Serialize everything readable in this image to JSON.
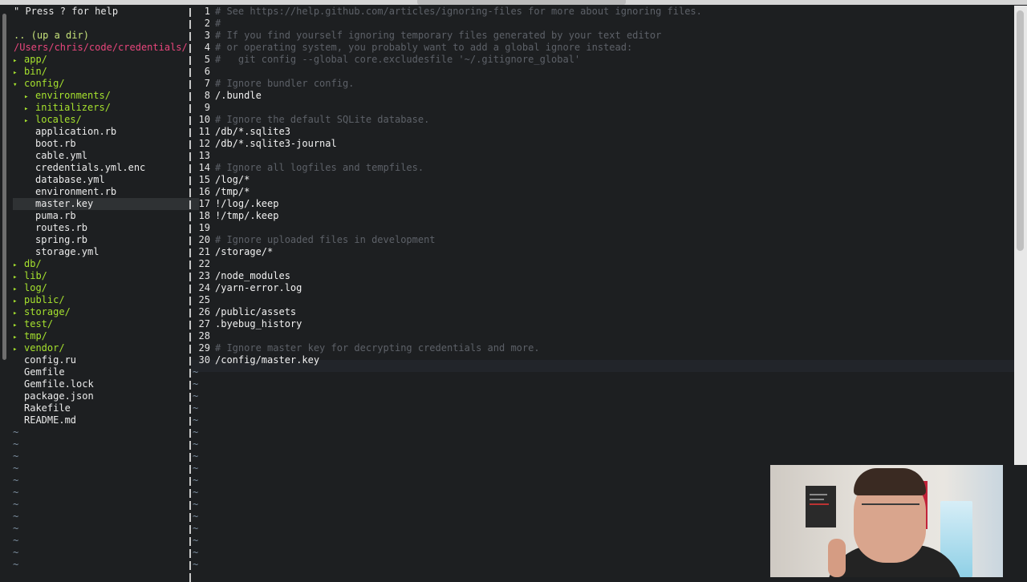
{
  "tree": {
    "help": "\" Press ? for help",
    "up_dir": ".. (up a dir)",
    "root_path": "/Users/chris/code/credentials/",
    "entries": [
      {
        "label": "app/",
        "type": "dir",
        "indent": 1,
        "expanded": false
      },
      {
        "label": "bin/",
        "type": "dir",
        "indent": 1,
        "expanded": false
      },
      {
        "label": "config/",
        "type": "dir",
        "indent": 1,
        "expanded": true
      },
      {
        "label": "environments/",
        "type": "dir",
        "indent": 2,
        "expanded": false
      },
      {
        "label": "initializers/",
        "type": "dir",
        "indent": 2,
        "expanded": false
      },
      {
        "label": "locales/",
        "type": "dir",
        "indent": 2,
        "expanded": false
      },
      {
        "label": "application.rb",
        "type": "file",
        "indent": 2
      },
      {
        "label": "boot.rb",
        "type": "file",
        "indent": 2
      },
      {
        "label": "cable.yml",
        "type": "file",
        "indent": 2
      },
      {
        "label": "credentials.yml.enc",
        "type": "file",
        "indent": 2
      },
      {
        "label": "database.yml",
        "type": "file",
        "indent": 2
      },
      {
        "label": "environment.rb",
        "type": "file",
        "indent": 2
      },
      {
        "label": "master.key",
        "type": "file",
        "indent": 2,
        "selected": true
      },
      {
        "label": "puma.rb",
        "type": "file",
        "indent": 2
      },
      {
        "label": "routes.rb",
        "type": "file",
        "indent": 2
      },
      {
        "label": "spring.rb",
        "type": "file",
        "indent": 2
      },
      {
        "label": "storage.yml",
        "type": "file",
        "indent": 2
      },
      {
        "label": "db/",
        "type": "dir",
        "indent": 1,
        "expanded": false
      },
      {
        "label": "lib/",
        "type": "dir",
        "indent": 1,
        "expanded": false
      },
      {
        "label": "log/",
        "type": "dir",
        "indent": 1,
        "expanded": false
      },
      {
        "label": "public/",
        "type": "dir",
        "indent": 1,
        "expanded": false
      },
      {
        "label": "storage/",
        "type": "dir",
        "indent": 1,
        "expanded": false
      },
      {
        "label": "test/",
        "type": "dir",
        "indent": 1,
        "expanded": false
      },
      {
        "label": "tmp/",
        "type": "dir",
        "indent": 1,
        "expanded": false
      },
      {
        "label": "vendor/",
        "type": "dir",
        "indent": 1,
        "expanded": false
      },
      {
        "label": "config.ru",
        "type": "file",
        "indent": 1
      },
      {
        "label": "Gemfile",
        "type": "file",
        "indent": 1
      },
      {
        "label": "Gemfile.lock",
        "type": "file",
        "indent": 1
      },
      {
        "label": "package.json",
        "type": "file",
        "indent": 1
      },
      {
        "label": "Rakefile",
        "type": "file",
        "indent": 1
      },
      {
        "label": "README.md",
        "type": "file",
        "indent": 1
      }
    ],
    "empty_marker": "~"
  },
  "editor": {
    "lines": [
      {
        "n": "1",
        "text": "# See https://help.github.com/articles/ignoring-files for more about ignoring files.",
        "comment": true
      },
      {
        "n": "2",
        "text": "#",
        "comment": true
      },
      {
        "n": "3",
        "text": "# If you find yourself ignoring temporary files generated by your text editor",
        "comment": true
      },
      {
        "n": "4",
        "text": "# or operating system, you probably want to add a global ignore instead:",
        "comment": true
      },
      {
        "n": "5",
        "text": "#   git config --global core.excludesfile '~/.gitignore_global'",
        "comment": true
      },
      {
        "n": "6",
        "text": "",
        "comment": false
      },
      {
        "n": "7",
        "text": "# Ignore bundler config.",
        "comment": true
      },
      {
        "n": "8",
        "text": "/.bundle",
        "comment": false
      },
      {
        "n": "9",
        "text": "",
        "comment": false
      },
      {
        "n": "10",
        "text": "# Ignore the default SQLite database.",
        "comment": true
      },
      {
        "n": "11",
        "text": "/db/*.sqlite3",
        "comment": false
      },
      {
        "n": "12",
        "text": "/db/*.sqlite3-journal",
        "comment": false
      },
      {
        "n": "13",
        "text": "",
        "comment": false
      },
      {
        "n": "14",
        "text": "# Ignore all logfiles and tempfiles.",
        "comment": true
      },
      {
        "n": "15",
        "text": "/log/*",
        "comment": false
      },
      {
        "n": "16",
        "text": "/tmp/*",
        "comment": false
      },
      {
        "n": "17",
        "text": "!/log/.keep",
        "comment": false
      },
      {
        "n": "18",
        "text": "!/tmp/.keep",
        "comment": false
      },
      {
        "n": "19",
        "text": "",
        "comment": false
      },
      {
        "n": "20",
        "text": "# Ignore uploaded files in development",
        "comment": true
      },
      {
        "n": "21",
        "text": "/storage/*",
        "comment": false
      },
      {
        "n": "22",
        "text": "",
        "comment": false
      },
      {
        "n": "23",
        "text": "/node_modules",
        "comment": false
      },
      {
        "n": "24",
        "text": "/yarn-error.log",
        "comment": false
      },
      {
        "n": "25",
        "text": "",
        "comment": false
      },
      {
        "n": "26",
        "text": "/public/assets",
        "comment": false
      },
      {
        "n": "27",
        "text": ".byebug_history",
        "comment": false
      },
      {
        "n": "28",
        "text": "",
        "comment": false
      },
      {
        "n": "29",
        "text": "# Ignore master key for decrypting credentials and more.",
        "comment": true
      },
      {
        "n": "30",
        "text": "/config/master.key",
        "comment": false
      }
    ],
    "empty_marker": "~"
  },
  "webcam": {
    "poster_text": "Life is short. Do stuff that matters."
  }
}
